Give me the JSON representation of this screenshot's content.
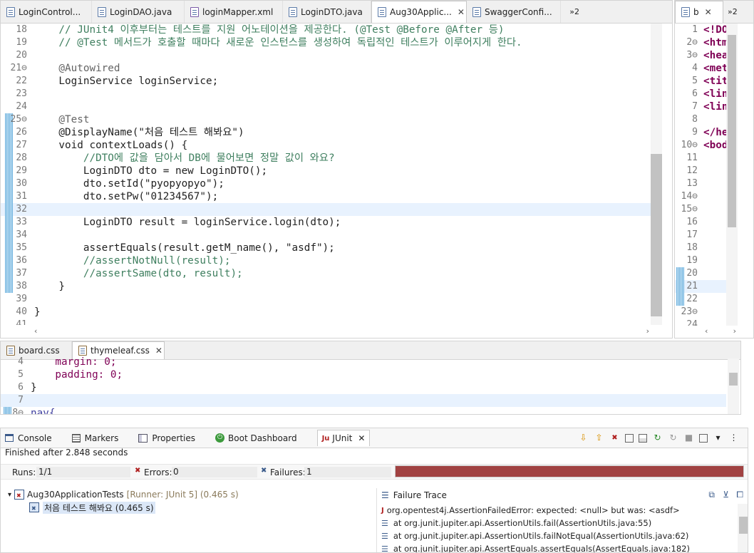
{
  "editor_tabs": [
    {
      "label": "LoginControl..."
    },
    {
      "label": "LoginDAO.java"
    },
    {
      "label": "loginMapper.xml"
    },
    {
      "label": "LoginDTO.java"
    },
    {
      "label": "Aug30Applic..."
    },
    {
      "label": "SwaggerConfi..."
    }
  ],
  "tab_overflow": "»2",
  "code_lines": [
    {
      "num": "18",
      "text": "    // JUnit4 이후부터는 테스트를 지원 어노테이션을 제공한다. (@Test @Before @After 등)"
    },
    {
      "num": "19",
      "text": "    // @Test 메서드가 호출할 때마다 새로운 인스턴스를 생성하여 독립적인 테스트가 이루어지게 한다."
    },
    {
      "num": "20",
      "text": ""
    },
    {
      "num": "21⊖",
      "text": "    @Autowired"
    },
    {
      "num": "22",
      "text": "    LoginService loginService;"
    },
    {
      "num": "23",
      "text": ""
    },
    {
      "num": "24",
      "text": ""
    },
    {
      "num": "25⊖",
      "text": "    @Test"
    },
    {
      "num": "26",
      "text": "    @DisplayName(\"처음 테스트 해봐요\")"
    },
    {
      "num": "27",
      "text": "    void contextLoads() {"
    },
    {
      "num": "28",
      "text": "        //DTO에 값을 담아서 DB에 물어보면 정말 값이 와요?"
    },
    {
      "num": "29",
      "text": "        LoginDTO dto = new LoginDTO();"
    },
    {
      "num": "30",
      "text": "        dto.setId(\"pyopyopyo\");"
    },
    {
      "num": "31",
      "text": "        dto.setPw(\"01234567\");"
    },
    {
      "num": "32",
      "text": ""
    },
    {
      "num": "33",
      "text": "        LoginDTO result = loginService.login(dto);"
    },
    {
      "num": "34",
      "text": ""
    },
    {
      "num": "35",
      "text": "        assertEquals(result.getM_name(), \"asdf\");"
    },
    {
      "num": "36",
      "text": "        //assertNotNull(result);"
    },
    {
      "num": "37",
      "text": "        //assertSame(dto, result);"
    },
    {
      "num": "38",
      "text": "    }"
    },
    {
      "num": "39",
      "text": ""
    },
    {
      "num": "40",
      "text": "}"
    },
    {
      "num": "41",
      "text": ""
    }
  ],
  "right_editor": {
    "tab_label": "b",
    "overflow": "»2",
    "lines": [
      {
        "num": "1",
        "text": "<!DO"
      },
      {
        "num": "2⊖",
        "text": "<htm"
      },
      {
        "num": "3⊖",
        "text": "<hea"
      },
      {
        "num": "4",
        "text": "<met"
      },
      {
        "num": "5",
        "text": "<tit"
      },
      {
        "num": "6",
        "text": "<lin"
      },
      {
        "num": "7",
        "text": "<lin"
      },
      {
        "num": "8",
        "text": ""
      },
      {
        "num": "9",
        "text": "</he"
      },
      {
        "num": "10⊖",
        "text": "<bod"
      },
      {
        "num": "11",
        "text": ""
      },
      {
        "num": "12",
        "text": ""
      },
      {
        "num": "13",
        "text": ""
      },
      {
        "num": "14⊖",
        "text": ""
      },
      {
        "num": "15⊖",
        "text": ""
      },
      {
        "num": "16",
        "text": ""
      },
      {
        "num": "17",
        "text": ""
      },
      {
        "num": "18",
        "text": ""
      },
      {
        "num": "19",
        "text": ""
      },
      {
        "num": "20",
        "text": ""
      },
      {
        "num": "21",
        "text": ""
      },
      {
        "num": "22",
        "text": ""
      },
      {
        "num": "23⊖",
        "text": ""
      },
      {
        "num": "24",
        "text": ""
      }
    ]
  },
  "css_tabs": [
    {
      "label": "board.css"
    },
    {
      "label": "thymeleaf.css"
    }
  ],
  "css_lines": [
    {
      "num": "4",
      "text": "    margin: 0;"
    },
    {
      "num": "5",
      "text": "    padding: 0;"
    },
    {
      "num": "6",
      "text": "}"
    },
    {
      "num": "7",
      "text": ""
    },
    {
      "num": "8⊖",
      "text": "nav{"
    }
  ],
  "view_tabs": [
    {
      "label": "Console"
    },
    {
      "label": "Markers"
    },
    {
      "label": "Properties"
    },
    {
      "label": "Boot Dashboard"
    },
    {
      "label": "JUnit"
    }
  ],
  "junit": {
    "status": "Finished after 2.848 seconds",
    "runs_label": "Runs:",
    "runs_value": "1/1",
    "errors_label": "Errors:",
    "errors_value": "0",
    "failures_label": "Failures:",
    "failures_value": "1",
    "bar_color": "#a14242",
    "tree_root": "Aug30ApplicationTests",
    "tree_root_meta": "[Runner: JUnit 5] (0.465 s)",
    "tree_child": "처음 테스트 해봐요 (0.465 s)",
    "trace_title": "Failure Trace",
    "trace_lines": [
      "org.opentest4j.AssertionFailedError: expected: <null> but was: <asdf>",
      "at org.junit.jupiter.api.AssertionUtils.fail(AssertionUtils.java:55)",
      "at org.junit.jupiter.api.AssertionUtils.failNotEqual(AssertionUtils.java:62)",
      "at org.junit.jupiter.api.AssertEquals.assertEquals(AssertEquals.java:182)"
    ]
  }
}
